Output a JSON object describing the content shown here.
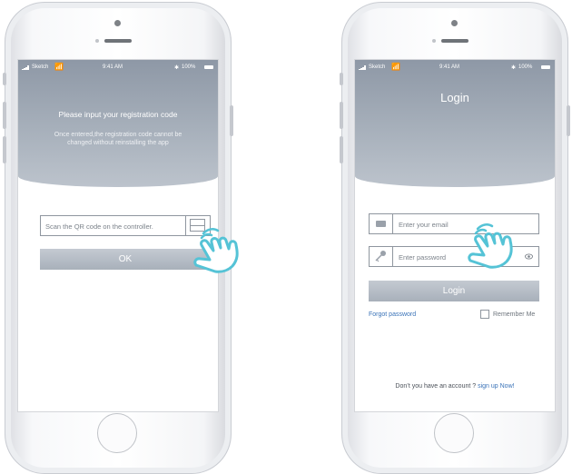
{
  "left_phone": {
    "status": {
      "carrier": "Sketch",
      "time": "9:41 AM",
      "battery": "100%"
    },
    "title": "Please input your registration code",
    "subtitle": "Once entered,the registration code cannot be changed without reinstalling the app",
    "qr_input": {
      "placeholder": "Scan the QR code on the controller."
    },
    "ok_button": "OK"
  },
  "right_phone": {
    "status": {
      "carrier": "Sketch",
      "time": "9:41 AM",
      "battery": "100%"
    },
    "title": "Login",
    "email_input": {
      "placeholder": "Enter your email"
    },
    "password_input": {
      "placeholder": "Enter password"
    },
    "login_button": "Login",
    "forgot_password": "Forgot password",
    "remember_me": "Remember Me",
    "remember_me_checked": false,
    "no_account_text": "Don’t you have an account ?",
    "signup_link": "sign up Now!"
  },
  "colors": {
    "header": "#a3acb8",
    "button": "#b4bbc4",
    "link": "#3a73b8",
    "hand_outline": "#55c3d6"
  },
  "icons": [
    "wifi-icon",
    "bluetooth-icon",
    "battery-icon",
    "qr-scan-icon",
    "email-icon",
    "key-icon",
    "eye-icon",
    "hand-pointer-icon"
  ]
}
